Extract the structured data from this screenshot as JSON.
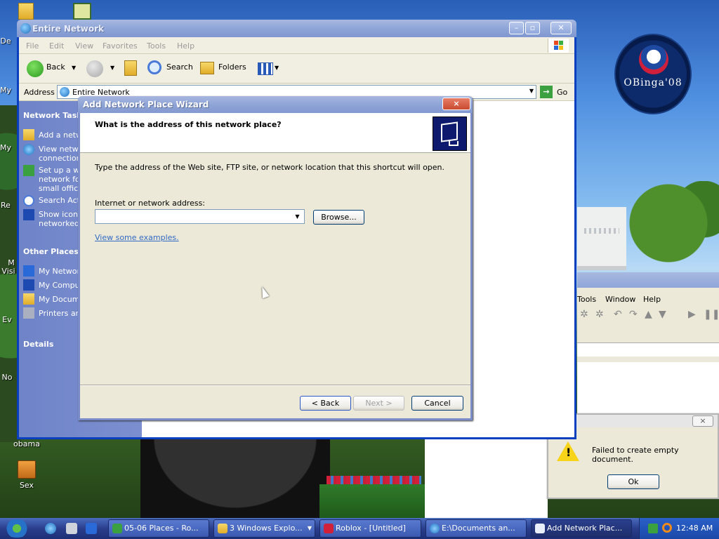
{
  "desktop": {
    "icons": [
      {
        "label": "obama"
      },
      {
        "label": "Sex"
      }
    ],
    "edge_labels": [
      "De",
      "My",
      "My",
      "Re",
      "M",
      "Visi",
      "Ev",
      "No"
    ],
    "logo_text": "OBinga'08"
  },
  "explorer": {
    "title": "Entire Network",
    "menu": [
      "File",
      "Edit",
      "View",
      "Favorites",
      "Tools",
      "Help"
    ],
    "toolbar": {
      "back": "Back",
      "search": "Search",
      "folders": "Folders"
    },
    "address_label": "Address",
    "address_value": "Entire Network",
    "go_label": "Go",
    "network_tasks_heading": "Network Tasks",
    "network_tasks": [
      {
        "label": "Add a netw"
      },
      {
        "label": "View netwo",
        "label2": "connection"
      },
      {
        "label": "Set up a wi",
        "label2": "network fo",
        "label3": "small office"
      },
      {
        "label": "Search Acti"
      },
      {
        "label": "Show icons",
        "label2": "networked"
      }
    ],
    "other_places_heading": "Other Places",
    "other_places": [
      "My Networ",
      "My Compu",
      "My Docum",
      "Printers an"
    ],
    "details_heading": "Details"
  },
  "wizard": {
    "title": "Add Network Place Wizard",
    "close": "×",
    "question": "What is the address of this network place?",
    "description": "Type the address of the Web site, FTP site, or network location that this shortcut will open.",
    "field_label": "Internet or network address:",
    "field_value": "",
    "browse": "Browse...",
    "examples_link": "View some examples.",
    "back": "< Back",
    "next": "Next >",
    "cancel": "Cancel"
  },
  "background_app": {
    "menu": [
      "Tools",
      "Window",
      "Help"
    ]
  },
  "error_dialog": {
    "close": "×",
    "message": "Failed to create empty document.",
    "ok": "Ok"
  },
  "taskbar": {
    "buttons": [
      {
        "label": "05-06 Places - Ro..."
      },
      {
        "label": "3 Windows Explo..."
      },
      {
        "label": "Roblox - [Untitled]"
      },
      {
        "label": "E:\\Documents an..."
      },
      {
        "label": "Add Network Plac..."
      }
    ],
    "clock": "12:48 AM"
  }
}
